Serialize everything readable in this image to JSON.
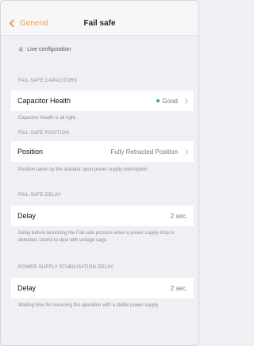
{
  "nav": {
    "back_label": "General",
    "title": "Fail safe"
  },
  "config": {
    "label": "Live configuration"
  },
  "capacitors": {
    "section": "FAIL-SAFE CAPACITORS",
    "title": "Capacitor Health",
    "value": "Good",
    "note": "Capacitor Health is all right."
  },
  "position": {
    "section": "FAIL-SAFE POSITION",
    "title": "Position",
    "value": "Fully Retracted Position",
    "note": "Position taken by the actuator upon power supply interruption"
  },
  "delay": {
    "section": "FAIL-SAFE DELAY",
    "title": "Delay",
    "value": "2 sec.",
    "note": "Delay before launching the Fail-safe process when a power supply drop is detected. Useful to deal with voltage sags."
  },
  "stabilisation": {
    "section": "POWER SUPPLY STABILISATION DELAY",
    "title": "Delay",
    "value": "2 sec.",
    "note": "Waiting time for resuming the operation with a stable power supply"
  },
  "colors": {
    "accent": "#f0a042",
    "good": "#3fb45a",
    "background": "#efeff4"
  }
}
